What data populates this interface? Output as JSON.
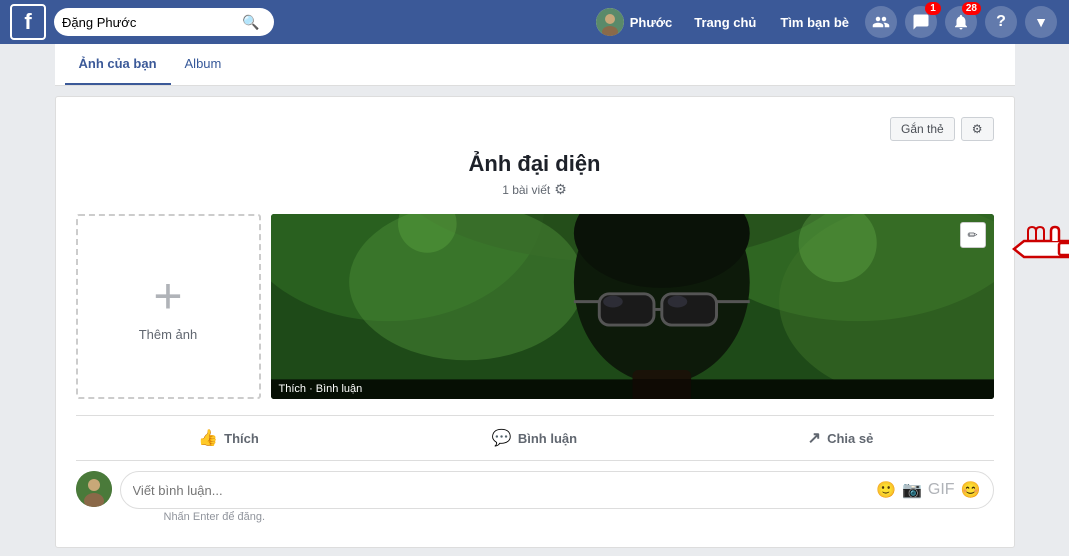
{
  "nav": {
    "logo": "f",
    "search_placeholder": "Đặng Phước",
    "user_name": "Phước",
    "trang_chu": "Trang chủ",
    "tim_ban_be": "Tìm bạn bè",
    "notification_count_1": "1",
    "notification_count_2": "28"
  },
  "sub_tabs": {
    "anh_cua_ban": "Ảnh của bạn",
    "album": "Album"
  },
  "top_actions": {
    "gan_the": "Gắn thẻ",
    "settings": "⚙"
  },
  "album": {
    "title": "Ảnh đại diện",
    "meta": "1 bài viết",
    "add_photo_label": "Thêm ảnh"
  },
  "photo_overlay": {
    "text": "Thích · Bình luận"
  },
  "action_bar": {
    "thich": "Thích",
    "binh_luan": "Bình luận",
    "chia_se": "Chia sẻ"
  },
  "comment": {
    "placeholder": "Viết bình luận...",
    "enter_hint": "Nhấn Enter để đăng."
  }
}
